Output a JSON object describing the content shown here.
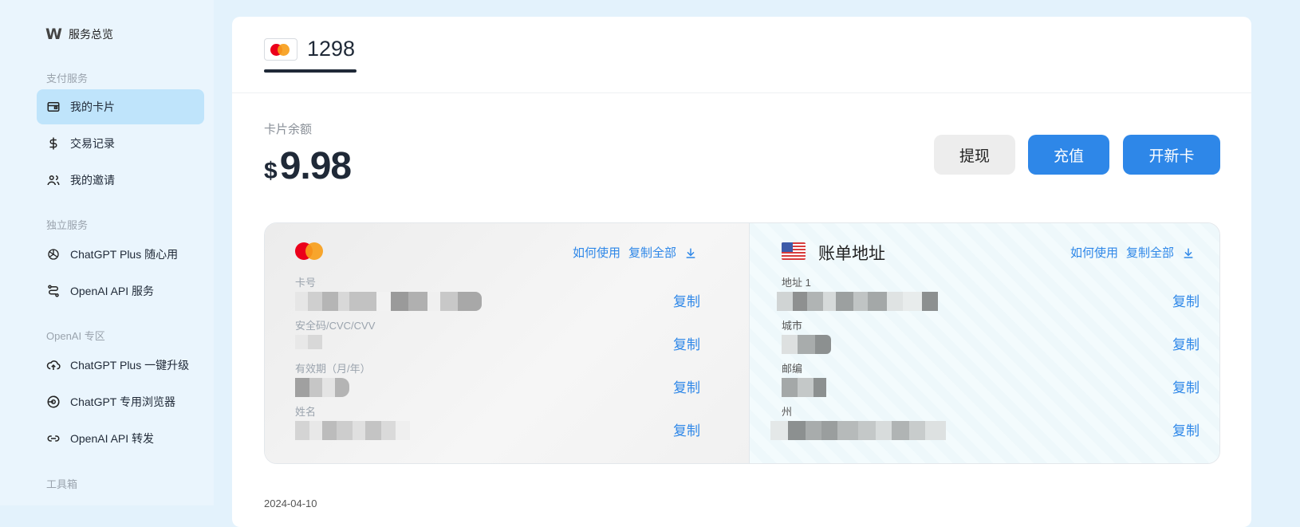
{
  "sidebar": {
    "brand_label": "服务总览",
    "sections": [
      {
        "title": "支付服务",
        "items": [
          "我的卡片",
          "交易记录",
          "我的邀请"
        ]
      },
      {
        "title": "独立服务",
        "items": [
          "ChatGPT Plus 随心用",
          "OpenAI API 服务"
        ]
      },
      {
        "title": "OpenAI 专区",
        "items": [
          "ChatGPT Plus 一键升级",
          "ChatGPT 专用浏览器",
          "OpenAI API 转发"
        ]
      },
      {
        "title": "工具箱",
        "items": []
      }
    ],
    "active_item": "我的卡片"
  },
  "card_tab": {
    "number": "1298"
  },
  "balance": {
    "label": "卡片余额",
    "currency": "$",
    "amount": "9.98"
  },
  "actions": {
    "withdraw": "提现",
    "topup": "充值",
    "new_card": "开新卡"
  },
  "card_panel": {
    "how_to_use": "如何使用",
    "copy_all": "复制全部",
    "fields": [
      {
        "label": "卡号",
        "copy": "复制"
      },
      {
        "label": "安全码/CVC/CVV",
        "copy": "复制"
      },
      {
        "label": "有效期（月/年）",
        "copy": "复制"
      },
      {
        "label": "姓名",
        "copy": "复制"
      }
    ]
  },
  "address_panel": {
    "title": "账单地址",
    "how_to_use": "如何使用",
    "copy_all": "复制全部",
    "fields": [
      {
        "label": "地址 1",
        "copy": "复制"
      },
      {
        "label": "城市",
        "copy": "复制"
      },
      {
        "label": "邮编",
        "copy": "复制"
      },
      {
        "label": "州",
        "copy": "复制"
      }
    ]
  },
  "footer": {
    "date": "2024-04-10"
  },
  "colors": {
    "accent": "#2e87e8",
    "active_nav": "#bfe4fb",
    "sidebar_bg": "#eaf5fd",
    "mastercard_red": "#eb001b",
    "mastercard_orange": "#f79e1b"
  }
}
